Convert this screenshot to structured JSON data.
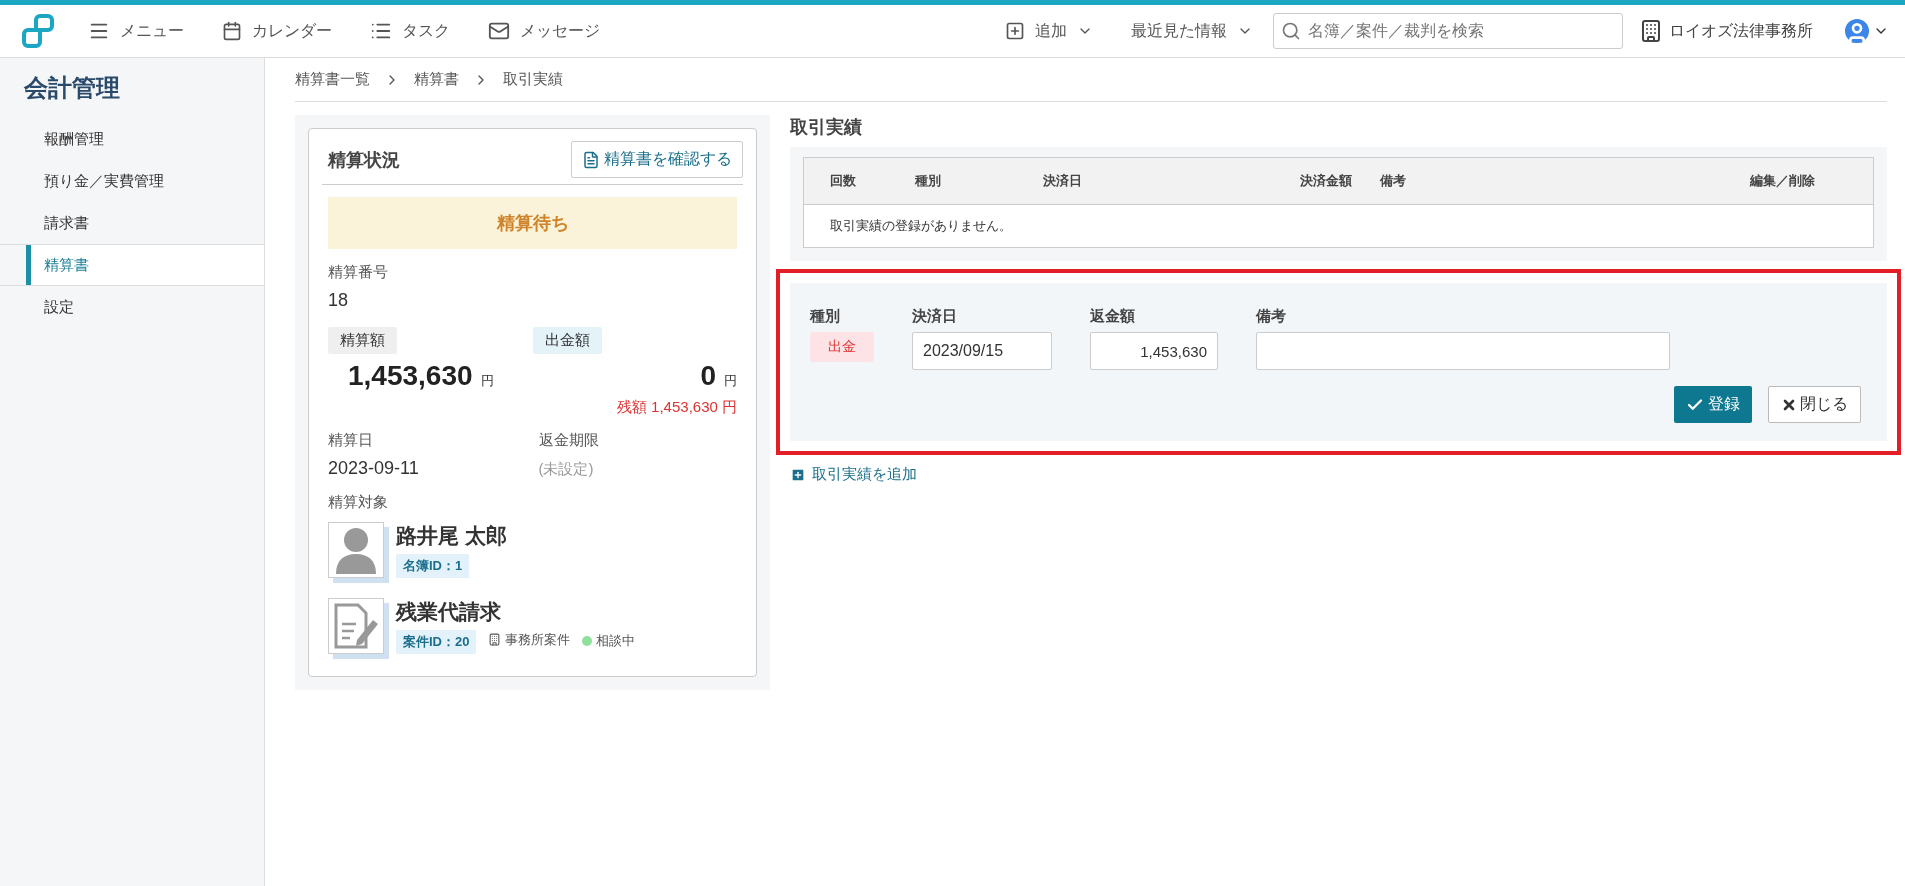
{
  "topbar": {
    "nav": [
      {
        "kind": "menu",
        "label": "メニュー"
      },
      {
        "kind": "calendar",
        "label": "カレンダー"
      },
      {
        "kind": "task",
        "label": "タスク"
      },
      {
        "kind": "message",
        "label": "メッセージ"
      }
    ],
    "add": "追加",
    "recent": "最近見た情報",
    "search": {
      "placeholder": "名簿／案件／裁判を検索"
    },
    "office": "ロイオズ法律事務所"
  },
  "sidebar": {
    "title": "会計管理",
    "items": [
      {
        "label": "報酬管理",
        "selected": false
      },
      {
        "label": "預り金／実費管理",
        "selected": false
      },
      {
        "label": "請求書",
        "selected": false
      },
      {
        "label": "精算書",
        "selected": true
      },
      {
        "label": "設定",
        "selected": false
      }
    ]
  },
  "breadcrumb": [
    "精算書一覧",
    "精算書",
    "取引実績"
  ],
  "status_card": {
    "title": "精算状況",
    "confirm_button": "精算書を確認する",
    "status": "精算待ち",
    "number_label": "精算番号",
    "number": "18",
    "amount_label": "精算額",
    "amount": "1,453,630",
    "amount_unit": "円",
    "paid_label": "出金額",
    "paid": "0",
    "paid_unit": "円",
    "remaining_label": "残額",
    "remaining": "1,453,630 円",
    "date_label": "精算日",
    "date": "2023-09-11",
    "deadline_label": "返金期限",
    "deadline": "(未設定)",
    "target_label": "精算対象",
    "targets": [
      {
        "kind": "person",
        "name": "路井尾 太郎",
        "id": "名簿ID：1"
      },
      {
        "kind": "case",
        "name": "残業代請求",
        "id": "案件ID：20",
        "category": "事務所案件",
        "status": "相談中",
        "color": "#8fe09a"
      }
    ]
  },
  "transactions": {
    "title": "取引実績",
    "columns": [
      "回数",
      "種別",
      "決済日",
      "決済金額",
      "備考",
      "編集／削除"
    ],
    "empty": "取引実績の登録がありません。",
    "form": {
      "type_label": "種別",
      "type": "出金",
      "date_label": "決済日",
      "date": "2023/09/15",
      "amount_label": "返金額",
      "amount": "1,453,630",
      "note_label": "備考",
      "submit": "登録",
      "close": "閉じる"
    },
    "add_link": "取引実績を追加"
  }
}
